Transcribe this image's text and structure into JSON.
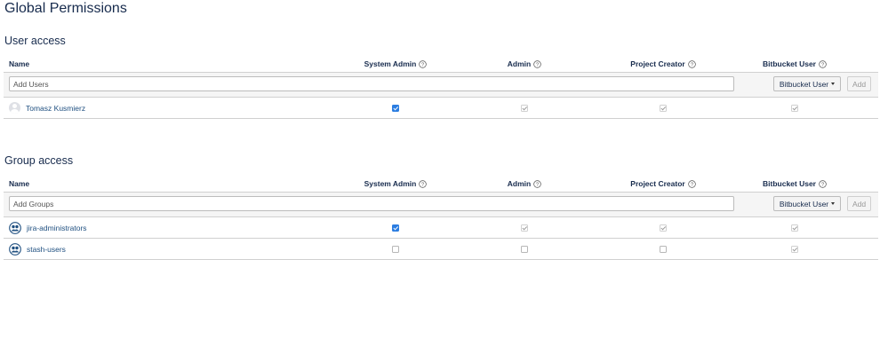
{
  "page": {
    "title": "Global Permissions"
  },
  "columns": {
    "name": "Name",
    "system_admin": "System Admin",
    "admin": "Admin",
    "project_creator": "Project Creator",
    "bitbucket_user": "Bitbucket User"
  },
  "user_access": {
    "title": "User access",
    "add_placeholder": "Add Users",
    "permission_select": "Bitbucket User",
    "add_button": "Add",
    "rows": [
      {
        "name": "Tomasz Kusmierz",
        "system_admin": "checked",
        "admin": "implied",
        "project_creator": "implied",
        "bitbucket_user": "implied"
      }
    ]
  },
  "group_access": {
    "title": "Group access",
    "add_placeholder": "Add Groups",
    "permission_select": "Bitbucket User",
    "add_button": "Add",
    "rows": [
      {
        "name": "jira-administrators",
        "system_admin": "checked",
        "admin": "implied",
        "project_creator": "implied",
        "bitbucket_user": "implied"
      },
      {
        "name": "stash-users",
        "system_admin": "unchecked",
        "admin": "unchecked",
        "project_creator": "unchecked",
        "bitbucket_user": "implied"
      }
    ]
  },
  "colors": {
    "link": "#205081",
    "checkbox_checked": "#2b7de1",
    "row_border": "#d0d0d0"
  },
  "icons": {
    "help": "question-circle-icon",
    "user": "user-avatar-icon",
    "group": "group-icon",
    "dropdown": "caret-down-icon"
  }
}
